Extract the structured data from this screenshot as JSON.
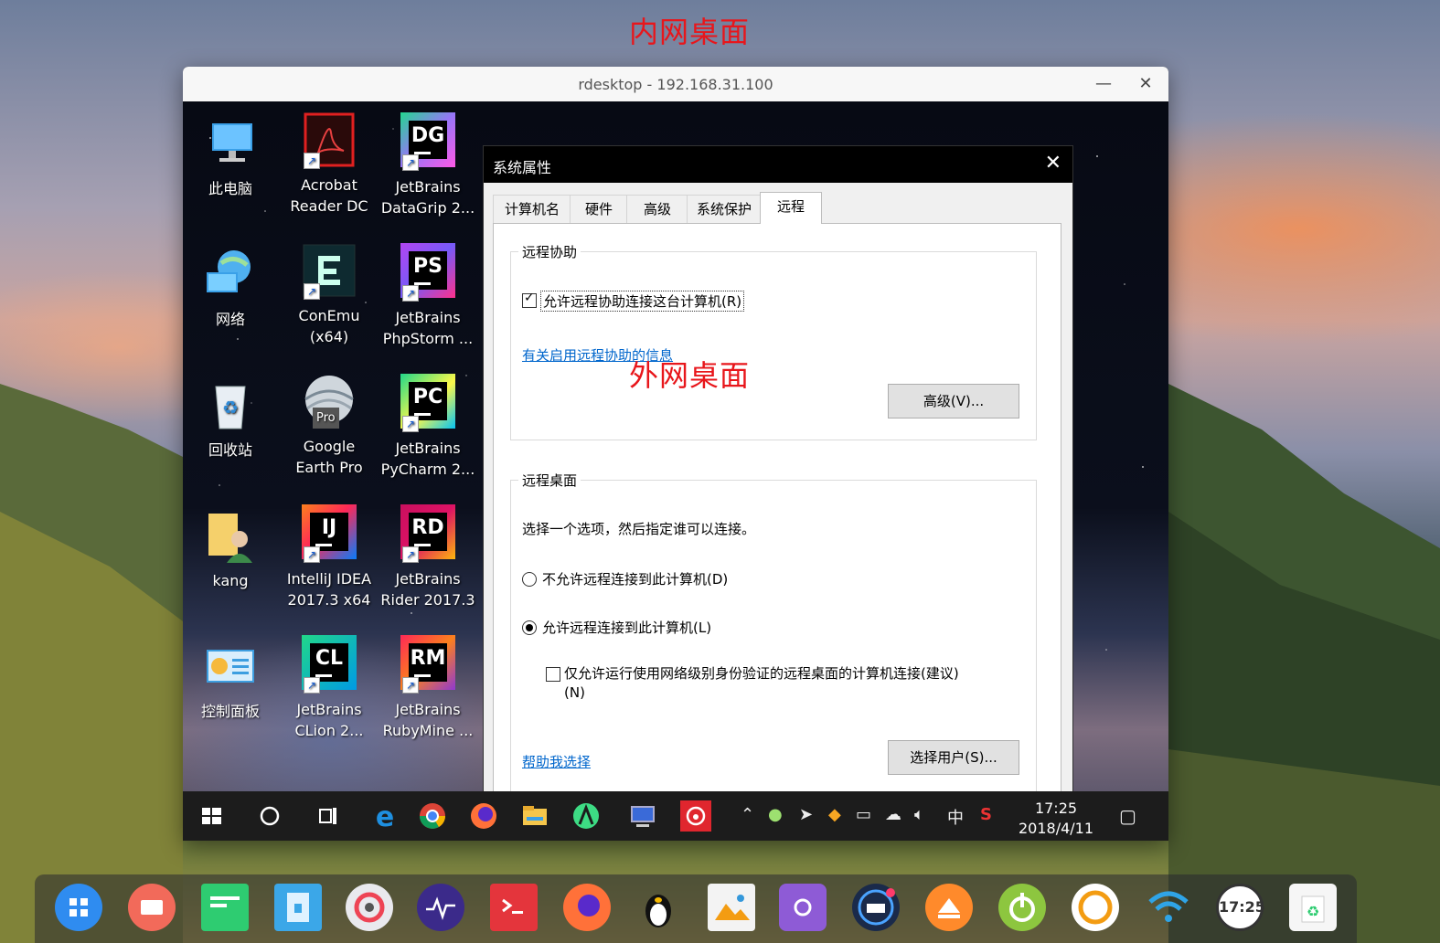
{
  "annotations": {
    "inner": "内网桌面",
    "outer": "外网桌面"
  },
  "window": {
    "title": "rdesktop - 192.168.31.100",
    "minimize": "—",
    "close": "✕"
  },
  "desktop_icons": [
    {
      "label1": "此电脑",
      "label2": "",
      "icon": "computer-icon"
    },
    {
      "label1": "Acrobat",
      "label2": "Reader DC",
      "icon": "acrobat-icon"
    },
    {
      "label1": "JetBrains",
      "label2": "DataGrip 2...",
      "icon": "datagrip-icon",
      "badge": "DG"
    },
    {
      "label1": "网络",
      "label2": "",
      "icon": "network-icon"
    },
    {
      "label1": "ConEmu",
      "label2": "(x64)",
      "icon": "conemu-icon"
    },
    {
      "label1": "JetBrains",
      "label2": "PhpStorm ...",
      "icon": "phpstorm-icon",
      "badge": "PS"
    },
    {
      "label1": "回收站",
      "label2": "",
      "icon": "recycle-bin-icon"
    },
    {
      "label1": "Google",
      "label2": "Earth Pro",
      "icon": "google-earth-icon",
      "badge": "Pro"
    },
    {
      "label1": "JetBrains",
      "label2": "PyCharm 2...",
      "icon": "pycharm-icon",
      "badge": "PC"
    },
    {
      "label1": "kang",
      "label2": "",
      "icon": "user-folder-icon"
    },
    {
      "label1": "IntelliJ IDEA",
      "label2": "2017.3 x64",
      "icon": "intellij-icon",
      "badge": "IJ"
    },
    {
      "label1": "JetBrains",
      "label2": "Rider 2017.3",
      "icon": "rider-icon",
      "badge": "RD"
    },
    {
      "label1": "控制面板",
      "label2": "",
      "icon": "control-panel-icon"
    },
    {
      "label1": "JetBrains",
      "label2": "CLion 2...",
      "icon": "clion-icon",
      "badge": "CL"
    },
    {
      "label1": "JetBrains",
      "label2": "RubyMine ...",
      "icon": "rubymine-icon",
      "badge": "RM"
    }
  ],
  "dialog": {
    "title": "系统属性",
    "close": "✕",
    "tabs": [
      "计算机名",
      "硬件",
      "高级",
      "系统保护",
      "远程"
    ],
    "active_tab": "远程",
    "assist": {
      "group": "远程协助",
      "checkbox": "允许远程协助连接这台计算机(R)",
      "checked": true,
      "link": "有关启用远程协助的信息",
      "advanced_button": "高级(V)..."
    },
    "desktop": {
      "group": "远程桌面",
      "intro": "选择一个选项，然后指定谁可以连接。",
      "radio1": "不允许远程连接到此计算机(D)",
      "radio2": "允许远程连接到此计算机(L)",
      "selected": "radio2",
      "nla_line1": "仅允许运行使用网络级别身份验证的远程桌面的计算机连接(建议)",
      "nla_line2": "(N)",
      "nla_checked": false,
      "help_link": "帮助我选择",
      "select_users_button": "选择用户(S)..."
    }
  },
  "taskbar": {
    "time": "17:25",
    "date": "2018/4/11",
    "ime": "中",
    "tray_icons": [
      "chevron-up-icon",
      "wechat-icon",
      "send-icon",
      "shield-icon",
      "network-icon",
      "onedrive-icon",
      "volume-icon",
      "ime-icon",
      "sogou-icon"
    ],
    "apps": [
      "start-icon",
      "cortana-icon",
      "task-view-icon",
      "edge-icon",
      "chrome-icon",
      "firefox-icon",
      "explorer-icon",
      "android-studio-icon",
      "remote-desktop-icon",
      "netease-music-icon"
    ]
  },
  "dock": {
    "items": [
      "launcher-icon",
      "multitasking-icon",
      "deepin-terminal-icon",
      "file-manager-icon",
      "settings-icon",
      "system-monitor-icon",
      "terminal-icon",
      "firefox-icon",
      "tux-icon",
      "image-viewer-icon",
      "deepin-store-icon",
      "onboard-keyboard-icon",
      "deepin-upload-icon",
      "power-icon",
      "spark-icon",
      "wifi-icon",
      "clock-icon",
      "trash-icon"
    ],
    "clock_text": "17:25"
  },
  "colors": {
    "annotation": "#e8161b",
    "link": "#0066cc",
    "taskbar": "#1c1c1c",
    "dialog_title": "#000000"
  }
}
